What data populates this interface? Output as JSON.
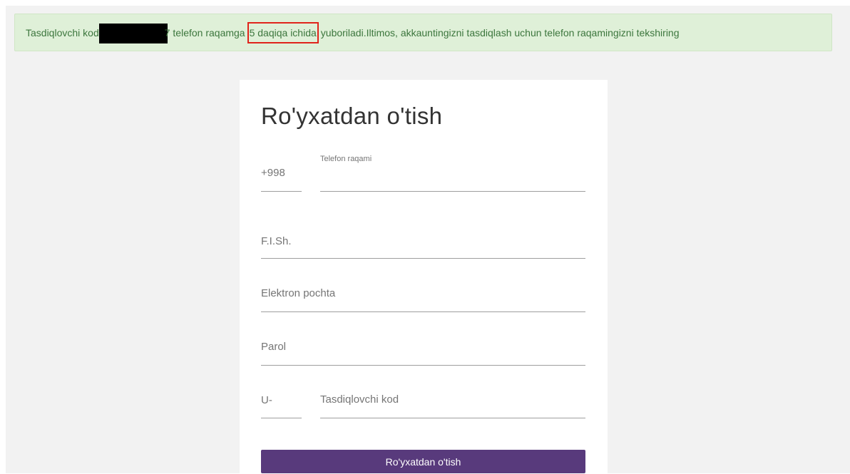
{
  "alert": {
    "prefix": "Tasdiqlovchi kod",
    "after_redact": "7 telefon raqamga",
    "highlight": "5 daqiqa ichida",
    "suffix": "yuboriladi.Iltimos, akkauntingizni tasdiqlash uchun telefon raqamingizni tekshiring"
  },
  "form": {
    "title": "Ro'yxatdan o'tish",
    "phone": {
      "prefix": "+998",
      "label": "Telefon raqami"
    },
    "fish": {
      "label": "F.I.Sh."
    },
    "email": {
      "label": "Elektron pochta"
    },
    "password": {
      "label": "Parol"
    },
    "code": {
      "prefix": "U-",
      "label": "Tasdiqlovchi kod"
    },
    "submit_label": "Ro'yxatdan o'tish"
  },
  "colors": {
    "alert_bg": "#dff0d8",
    "alert_text": "#3c763d",
    "highlight_border": "#e0241b",
    "button_bg": "#583a7c"
  }
}
